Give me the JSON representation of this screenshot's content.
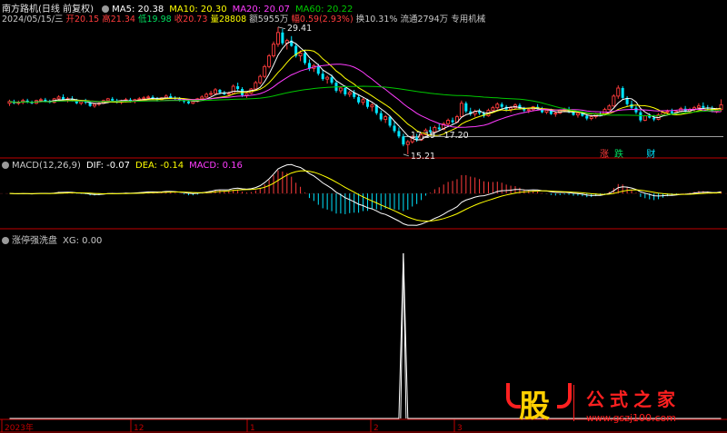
{
  "colors": {
    "up": "#ff3c3c",
    "down": "#00e5ff",
    "white": "#ffffff",
    "yellow": "#ffff00",
    "magenta": "#ff3cff",
    "green": "#00c800",
    "frame": "#c00000",
    "dash": "#303030",
    "logo_red": "#ff2020",
    "logo_gold": "#ffd000"
  },
  "header": {
    "stock_name": "南方路机",
    "period": "(日线 前复权)",
    "ma5": "MA5: 20.38",
    "ma10": "MA10: 20.30",
    "ma20": "MA20: 20.07",
    "ma60": "MA60: 20.22"
  },
  "info": {
    "date": "2024/05/15/三",
    "open": "开20.15",
    "high": "高21.34",
    "low": "低19.98",
    "close": "收20.73",
    "vol": "量28808",
    "amount": "额5955万",
    "change": "幅0.59(2.93%)",
    "turnover": "换10.31%",
    "float_cap": "流通2794万",
    "sector": "专用机械"
  },
  "annotations": {
    "peak": "29.41",
    "low": "15.21",
    "range": "17.19 - 17.20",
    "tag_limit_up": "涨",
    "tag_limit_down": "跌",
    "tag_fin": "财"
  },
  "macd_header": {
    "title": "MACD(12,26,9)",
    "dif": "DIF: -0.07",
    "dea": "DEA: -0.14",
    "macd": "MACD: 0.16"
  },
  "xg_header": {
    "title": "涨停强洗盘",
    "xg": "XG: 0.00"
  },
  "axis": {
    "labels": [
      "2023年",
      "12",
      "1",
      "2",
      "3"
    ]
  },
  "logo": {
    "glyph": "股",
    "text": "公式之家",
    "url": "www.gszj100.com"
  },
  "chart_data": [
    {
      "type": "candlestick",
      "title": "南方路机 (日线 前复权)",
      "candles": [
        [
          20.9,
          21.3,
          20.6,
          21.1
        ],
        [
          21.1,
          21.3,
          20.8,
          20.9
        ],
        [
          20.9,
          21.2,
          20.7,
          21.0
        ],
        [
          21.0,
          21.4,
          20.8,
          21.2
        ],
        [
          21.2,
          21.4,
          20.9,
          21.0
        ],
        [
          21.0,
          21.2,
          20.8,
          20.9
        ],
        [
          20.9,
          21.3,
          20.8,
          21.2
        ],
        [
          21.2,
          21.5,
          21.0,
          21.3
        ],
        [
          21.3,
          21.5,
          21.0,
          21.1
        ],
        [
          21.1,
          21.3,
          20.9,
          21.0
        ],
        [
          21.0,
          21.5,
          20.9,
          21.4
        ],
        [
          21.4,
          21.8,
          21.2,
          21.6
        ],
        [
          21.6,
          21.9,
          21.2,
          21.3
        ],
        [
          21.3,
          21.6,
          21.0,
          21.4
        ],
        [
          21.4,
          21.7,
          21.1,
          21.2
        ],
        [
          21.2,
          21.4,
          20.8,
          20.9
        ],
        [
          20.9,
          21.2,
          20.7,
          21.1
        ],
        [
          21.1,
          21.4,
          20.8,
          21.0
        ],
        [
          21.0,
          21.1,
          20.5,
          20.6
        ],
        [
          20.6,
          20.9,
          20.4,
          20.8
        ],
        [
          20.8,
          21.1,
          20.6,
          20.9
        ],
        [
          20.9,
          21.3,
          20.8,
          21.2
        ],
        [
          21.2,
          21.5,
          21.0,
          21.4
        ],
        [
          21.4,
          21.6,
          21.1,
          21.2
        ],
        [
          21.2,
          21.4,
          20.9,
          21.0
        ],
        [
          21.0,
          21.3,
          20.8,
          21.2
        ],
        [
          21.2,
          21.5,
          21.0,
          21.3
        ],
        [
          21.3,
          21.5,
          21.0,
          21.1
        ],
        [
          21.1,
          21.4,
          20.9,
          21.3
        ],
        [
          21.3,
          21.6,
          21.1,
          21.4
        ],
        [
          21.4,
          21.7,
          21.2,
          21.5
        ],
        [
          21.5,
          21.8,
          21.3,
          21.6
        ],
        [
          21.6,
          21.8,
          21.3,
          21.4
        ],
        [
          21.4,
          21.6,
          21.1,
          21.3
        ],
        [
          21.3,
          21.6,
          21.2,
          21.5
        ],
        [
          21.5,
          21.9,
          21.4,
          21.7
        ],
        [
          21.7,
          22.0,
          21.4,
          21.5
        ],
        [
          21.5,
          21.7,
          21.2,
          21.4
        ],
        [
          21.4,
          21.6,
          21.1,
          21.2
        ],
        [
          21.2,
          21.4,
          20.9,
          21.1
        ],
        [
          21.1,
          21.3,
          20.8,
          20.9
        ],
        [
          20.9,
          21.2,
          20.8,
          21.1
        ],
        [
          21.1,
          21.5,
          21.0,
          21.4
        ],
        [
          21.4,
          21.8,
          21.2,
          21.6
        ],
        [
          21.6,
          22.1,
          21.5,
          21.9
        ],
        [
          21.9,
          22.3,
          21.7,
          22.0
        ],
        [
          22.0,
          22.6,
          21.8,
          22.4
        ],
        [
          22.4,
          22.5,
          21.9,
          22.1
        ],
        [
          22.1,
          22.3,
          21.8,
          21.9
        ],
        [
          21.9,
          22.2,
          21.7,
          22.0
        ],
        [
          22.0,
          23.0,
          21.9,
          22.8
        ],
        [
          22.8,
          23.2,
          22.3,
          22.5
        ],
        [
          22.5,
          22.7,
          21.6,
          21.8
        ],
        [
          21.8,
          22.2,
          21.5,
          22.0
        ],
        [
          22.0,
          22.6,
          21.9,
          22.5
        ],
        [
          22.5,
          23.4,
          22.4,
          23.2
        ],
        [
          23.2,
          24.1,
          23.0,
          23.9
        ],
        [
          23.9,
          25.2,
          23.7,
          25.0
        ],
        [
          25.0,
          26.4,
          24.8,
          26.2
        ],
        [
          26.2,
          27.8,
          26.0,
          27.5
        ],
        [
          27.5,
          29.41,
          27.2,
          28.8
        ],
        [
          28.8,
          29.2,
          27.4,
          27.6
        ],
        [
          27.6,
          28.1,
          26.9,
          27.9
        ],
        [
          27.9,
          28.4,
          27.2,
          27.3
        ],
        [
          27.3,
          27.6,
          26.0,
          26.2
        ],
        [
          26.2,
          26.8,
          25.6,
          26.5
        ],
        [
          26.5,
          26.9,
          25.2,
          25.4
        ],
        [
          25.4,
          25.8,
          24.5,
          24.8
        ],
        [
          24.8,
          25.3,
          24.4,
          25.1
        ],
        [
          25.1,
          25.3,
          24.0,
          24.2
        ],
        [
          24.2,
          24.6,
          23.4,
          23.6
        ],
        [
          23.6,
          24.0,
          23.1,
          23.8
        ],
        [
          23.8,
          24.1,
          23.0,
          23.2
        ],
        [
          23.2,
          23.4,
          22.1,
          22.3
        ],
        [
          22.3,
          22.8,
          22.0,
          22.6
        ],
        [
          22.6,
          22.9,
          21.7,
          21.9
        ],
        [
          21.9,
          22.3,
          21.6,
          22.1
        ],
        [
          22.1,
          22.4,
          21.4,
          21.6
        ],
        [
          21.6,
          21.9,
          20.8,
          21.0
        ],
        [
          21.0,
          21.5,
          20.7,
          21.3
        ],
        [
          21.3,
          21.4,
          20.3,
          20.5
        ],
        [
          20.5,
          20.9,
          20.0,
          20.7
        ],
        [
          20.7,
          20.8,
          19.6,
          19.8
        ],
        [
          19.8,
          20.1,
          18.9,
          19.1
        ],
        [
          19.1,
          19.6,
          18.7,
          19.4
        ],
        [
          19.4,
          19.5,
          18.2,
          18.4
        ],
        [
          18.4,
          18.8,
          17.6,
          17.8
        ],
        [
          17.8,
          18.2,
          17.0,
          17.2
        ],
        [
          17.2,
          17.5,
          16.1,
          16.3
        ],
        [
          16.3,
          16.8,
          15.21,
          16.6
        ],
        [
          16.6,
          17.3,
          16.4,
          17.1
        ],
        [
          17.1,
          17.5,
          16.6,
          16.8
        ],
        [
          16.8,
          17.6,
          16.7,
          17.4
        ],
        [
          17.4,
          18.1,
          17.3,
          17.9
        ],
        [
          17.9,
          18.3,
          17.5,
          17.7
        ],
        [
          17.7,
          18.4,
          17.6,
          18.2
        ],
        [
          18.2,
          18.6,
          17.9,
          18.0
        ],
        [
          18.0,
          18.8,
          17.9,
          18.6
        ],
        [
          18.6,
          19.2,
          18.4,
          19.0
        ],
        [
          19.0,
          19.3,
          18.6,
          18.8
        ],
        [
          18.8,
          19.6,
          18.7,
          19.4
        ],
        [
          19.4,
          21.2,
          19.3,
          20.9
        ],
        [
          20.9,
          21.1,
          19.8,
          20.0
        ],
        [
          20.0,
          20.4,
          19.5,
          19.7
        ],
        [
          19.7,
          20.2,
          19.4,
          20.0
        ],
        [
          20.0,
          20.3,
          19.6,
          19.8
        ],
        [
          19.8,
          20.0,
          19.3,
          19.5
        ],
        [
          19.5,
          20.3,
          19.4,
          20.1
        ],
        [
          20.1,
          20.6,
          19.9,
          20.4
        ],
        [
          20.4,
          21.0,
          20.2,
          20.8
        ],
        [
          20.8,
          21.0,
          20.3,
          20.5
        ],
        [
          20.5,
          20.7,
          20.0,
          20.2
        ],
        [
          20.2,
          20.6,
          19.9,
          20.4
        ],
        [
          20.4,
          20.9,
          20.2,
          20.7
        ],
        [
          20.7,
          20.9,
          20.2,
          20.3
        ],
        [
          20.3,
          20.5,
          19.9,
          20.1
        ],
        [
          20.1,
          20.4,
          19.8,
          20.2
        ],
        [
          20.2,
          20.6,
          20.0,
          20.5
        ],
        [
          20.5,
          20.8,
          20.2,
          20.3
        ],
        [
          20.3,
          20.5,
          19.8,
          19.9
        ],
        [
          19.9,
          20.2,
          19.7,
          20.1
        ],
        [
          20.1,
          20.3,
          19.6,
          19.7
        ],
        [
          19.7,
          20.0,
          19.4,
          19.8
        ],
        [
          19.8,
          20.2,
          19.7,
          20.1
        ],
        [
          20.1,
          20.4,
          19.9,
          20.2
        ],
        [
          20.2,
          20.5,
          19.8,
          19.9
        ],
        [
          19.9,
          20.1,
          19.5,
          19.6
        ],
        [
          19.6,
          19.9,
          19.3,
          19.8
        ],
        [
          19.8,
          20.0,
          19.4,
          19.5
        ],
        [
          19.5,
          19.7,
          19.0,
          19.2
        ],
        [
          19.2,
          19.6,
          19.0,
          19.4
        ],
        [
          19.4,
          19.8,
          19.2,
          19.7
        ],
        [
          19.7,
          20.0,
          19.5,
          19.6
        ],
        [
          19.6,
          20.4,
          19.5,
          20.2
        ],
        [
          20.2,
          20.8,
          20.1,
          20.6
        ],
        [
          20.6,
          21.9,
          20.5,
          21.7
        ],
        [
          21.7,
          22.9,
          21.4,
          22.6
        ],
        [
          22.6,
          22.8,
          21.3,
          21.5
        ],
        [
          21.5,
          21.7,
          20.6,
          20.8
        ],
        [
          20.8,
          21.2,
          20.2,
          20.4
        ],
        [
          20.4,
          20.6,
          19.7,
          19.9
        ],
        [
          19.9,
          20.1,
          18.8,
          19.0
        ],
        [
          19.0,
          19.6,
          18.9,
          19.5
        ],
        [
          19.5,
          19.8,
          19.2,
          19.3
        ],
        [
          19.3,
          19.6,
          18.9,
          19.1
        ],
        [
          19.1,
          19.8,
          19.0,
          19.6
        ],
        [
          19.6,
          20.0,
          19.5,
          19.9
        ],
        [
          19.9,
          20.2,
          19.6,
          20.0
        ],
        [
          20.0,
          20.3,
          19.7,
          19.8
        ],
        [
          19.8,
          20.1,
          19.6,
          20.0
        ],
        [
          20.0,
          20.5,
          19.9,
          20.3
        ],
        [
          20.3,
          20.6,
          19.9,
          20.0
        ],
        [
          20.0,
          20.4,
          19.8,
          20.2
        ],
        [
          20.2,
          20.6,
          20.0,
          20.4
        ],
        [
          20.4,
          20.9,
          20.2,
          20.6
        ],
        [
          20.6,
          21.0,
          20.3,
          20.4
        ],
        [
          20.4,
          20.7,
          20.1,
          20.3
        ],
        [
          20.3,
          20.6,
          19.9,
          20.0
        ],
        [
          20.0,
          20.4,
          19.8,
          20.2
        ],
        [
          20.2,
          21.34,
          19.98,
          20.73
        ]
      ],
      "ylim": [
        15.0,
        30.2
      ],
      "reference_level": 20.2,
      "ma": [
        {
          "name": "MA5",
          "color": "#ffffff",
          "period": 5
        },
        {
          "name": "MA10",
          "color": "#ffff00",
          "period": 10
        },
        {
          "name": "MA20",
          "color": "#ff3cff",
          "period": 20
        },
        {
          "name": "MA60",
          "color": "#00c800",
          "period": 60
        }
      ]
    },
    {
      "type": "bar",
      "title": "MACD(12,26,9)",
      "series": [
        {
          "name": "DIF",
          "source": "ema12-ema26",
          "color": "#ffffff"
        },
        {
          "name": "DEA",
          "source": "ema9(DIF)",
          "color": "#ffff00"
        },
        {
          "name": "MACD",
          "source": "2*(DIF-DEA)",
          "color_pos": "#ff3c3c",
          "color_neg": "#00e5ff"
        }
      ],
      "ylim": [
        -1.9,
        1.5
      ]
    },
    {
      "type": "line",
      "title": "涨停强洗盘",
      "series": [
        {
          "name": "XG",
          "spike_index": 88,
          "values_note": "0 except spike",
          "peak": 1.0
        }
      ],
      "ylim": [
        0,
        1.05
      ]
    }
  ]
}
